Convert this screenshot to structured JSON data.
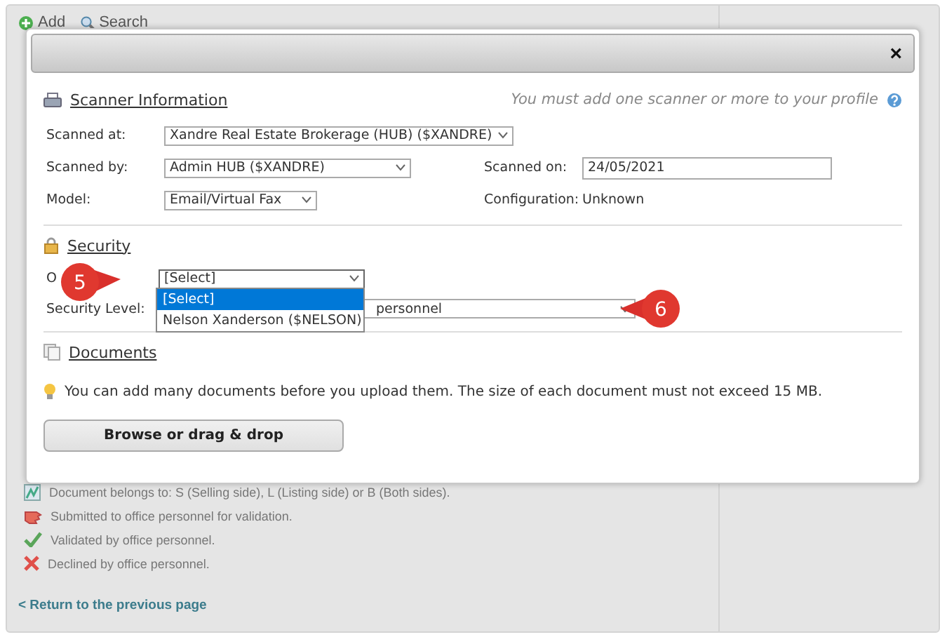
{
  "toolbar": [
    {
      "kind": "add",
      "label": "Add"
    },
    {
      "kind": "search",
      "label": "Search"
    }
  ],
  "legend": [
    {
      "kind": "sides",
      "text": "Document belongs to: S (Selling side), L (Listing side) or B (Both sides)."
    },
    {
      "kind": "submitted",
      "text": "Submitted to office personnel for validation."
    },
    {
      "kind": "validated",
      "text": "Validated by office personnel."
    },
    {
      "kind": "declined",
      "text": "Declined by office personnel."
    }
  ],
  "back_link": "< Return to the previous page",
  "dialog": {
    "close": "×",
    "scanner": {
      "title": "Scanner Information",
      "hint": "You must add one scanner or more to your profile",
      "scanned_at": {
        "label": "Scanned at:",
        "value": "Xandre Real Estate Brokerage (HUB) ($XANDRE)"
      },
      "scanned_by": {
        "label": "Scanned by:",
        "value": "Admin HUB ($XANDRE)"
      },
      "scanned_on": {
        "label": "Scanned on:",
        "value": "24/05/2021"
      },
      "model": {
        "label": "Model:",
        "value": "Email/Virtual Fax"
      },
      "configuration": {
        "label": "Configuration:",
        "value": "Unknown"
      }
    },
    "security": {
      "title": "Security",
      "owner": {
        "label": "O",
        "value": "[Select]",
        "expanded": true,
        "options": [
          {
            "label": "[Select]",
            "selected": true
          },
          {
            "label": "Nelson Xanderson ($NELSON)",
            "selected": false
          }
        ]
      },
      "level": {
        "label": "Security Level:",
        "value": "personnel"
      }
    },
    "documents": {
      "title": "Documents",
      "tip": "You can add many documents before you upload them. The size of each document must not exceed 15 MB.",
      "button": "Browse or drag & drop"
    }
  },
  "callouts": [
    {
      "label": "5",
      "kind": "right"
    },
    {
      "label": "6",
      "kind": "left"
    }
  ]
}
